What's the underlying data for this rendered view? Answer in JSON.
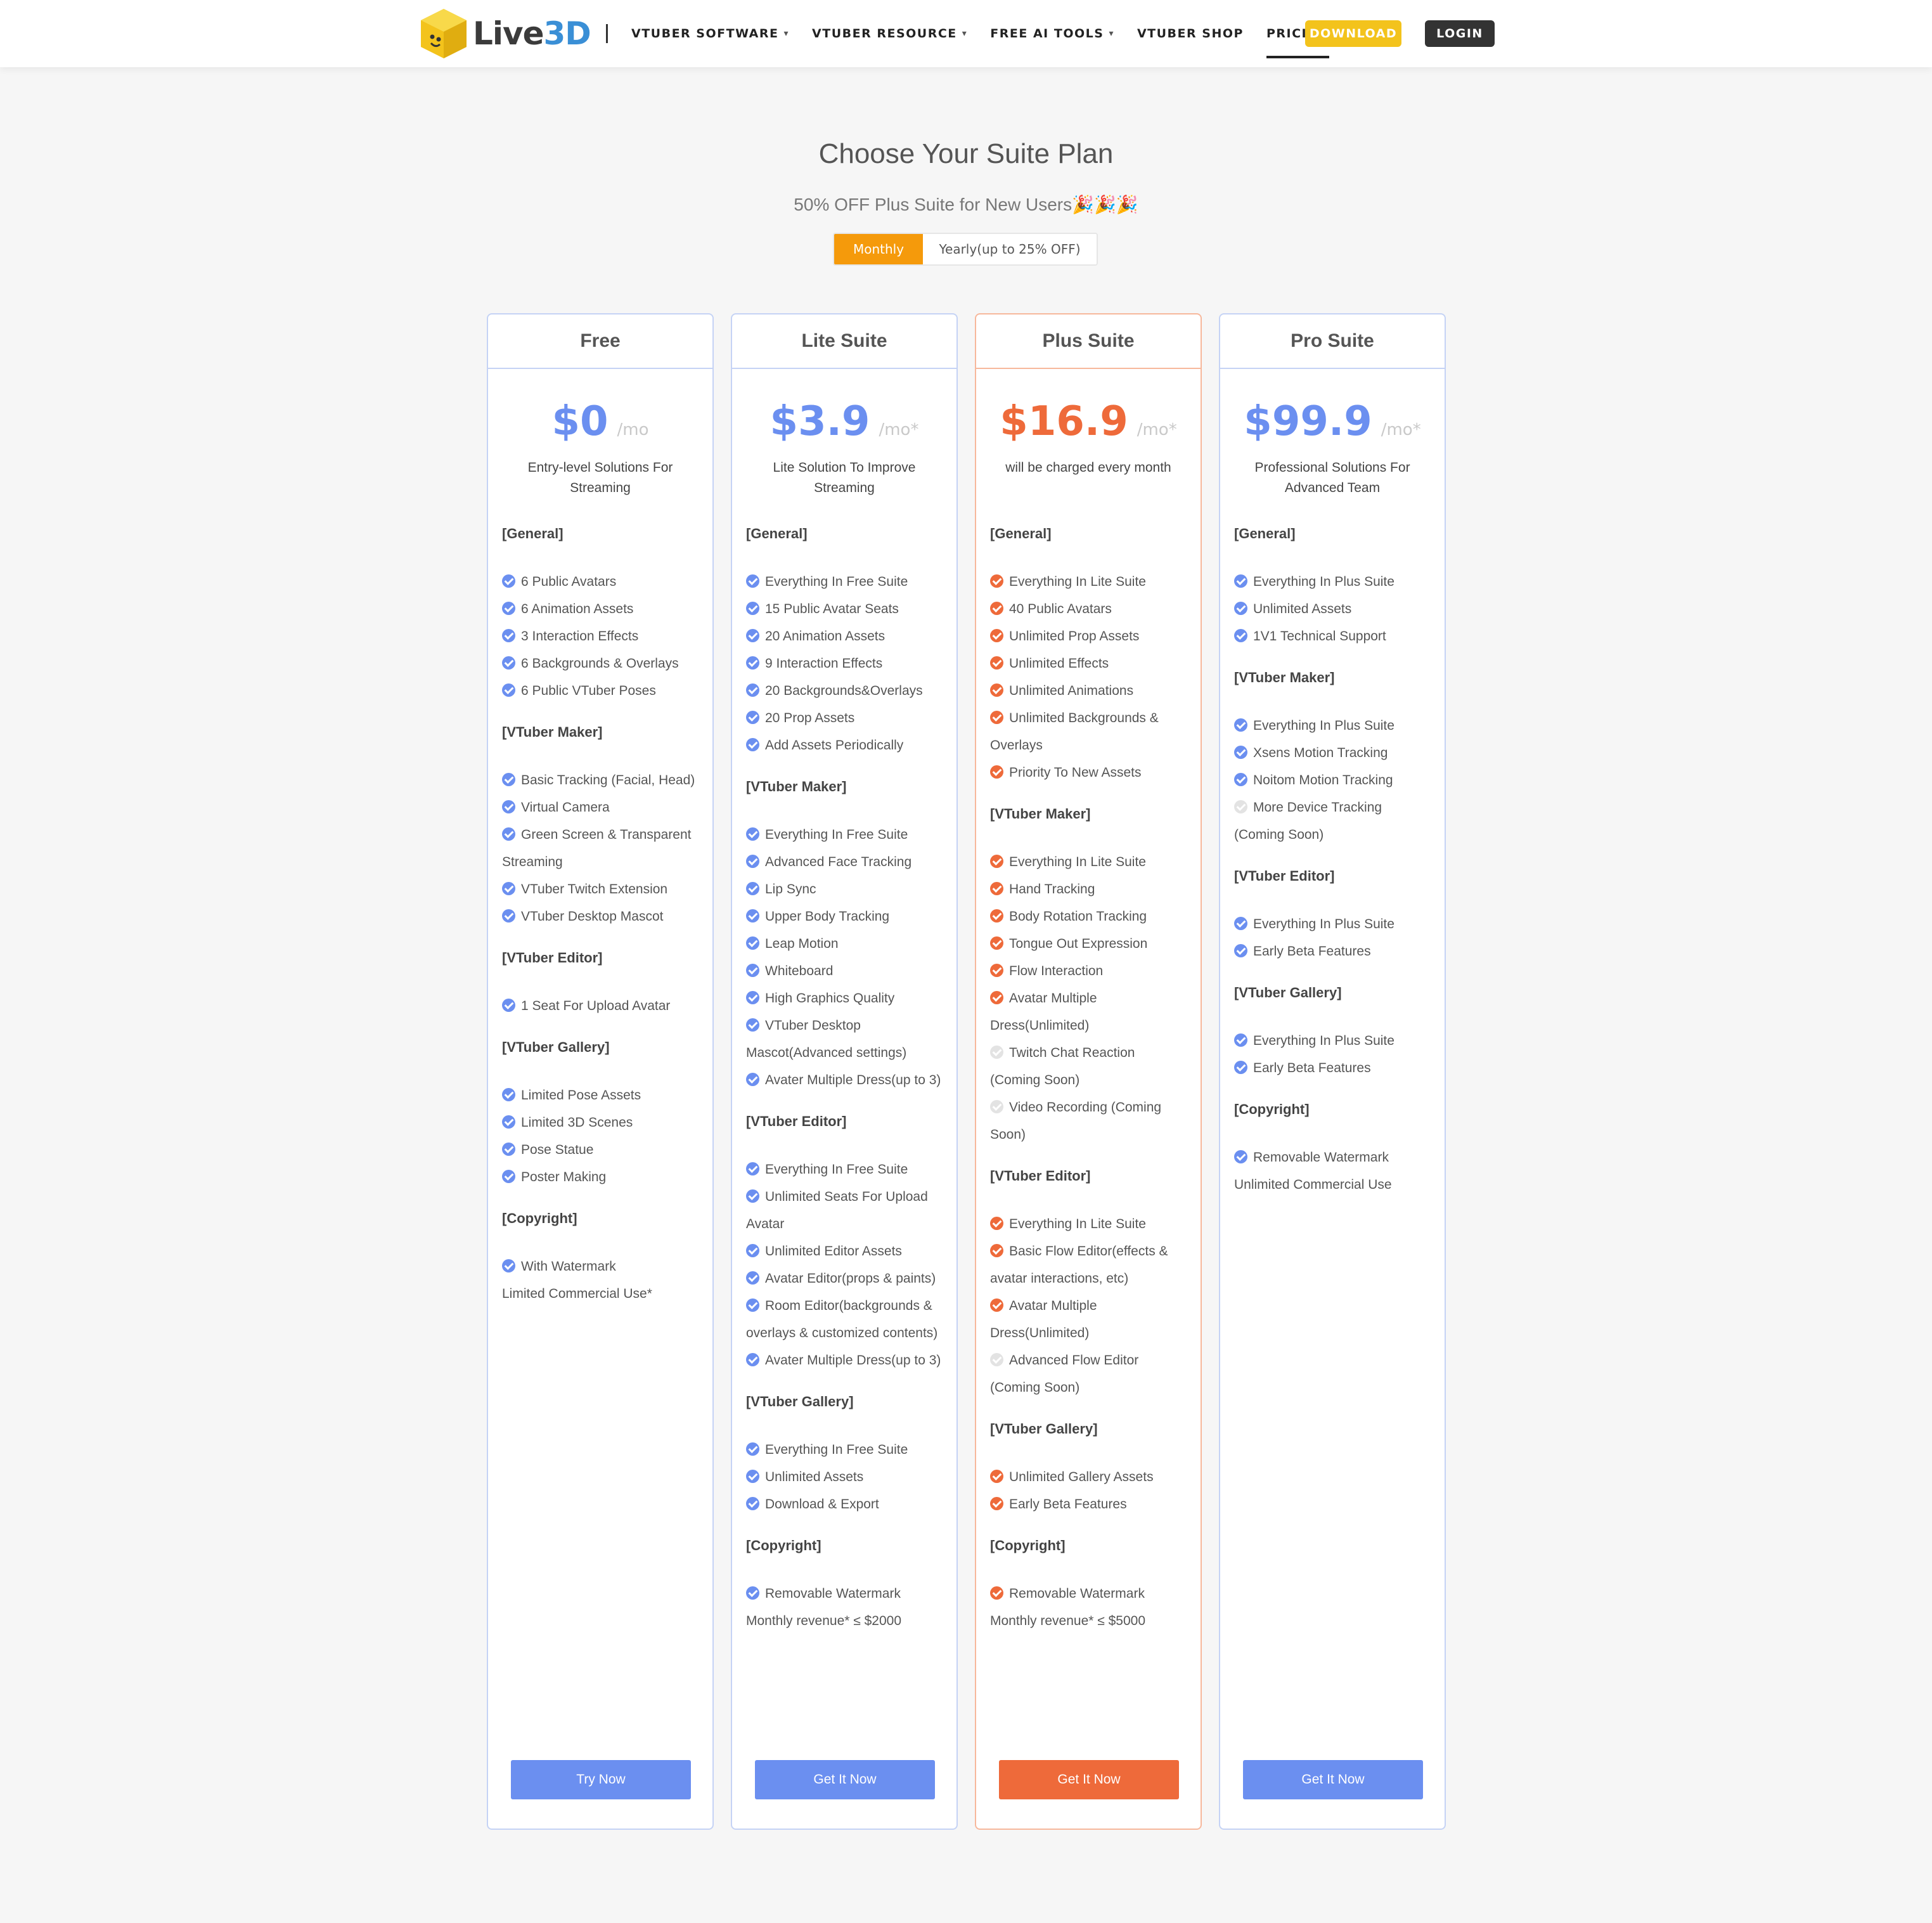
{
  "brand": {
    "logo_text_a": "Live",
    "logo_text_b": "3D",
    "logo_icon": "yellow-cube-icon"
  },
  "nav": {
    "items": [
      {
        "label": "VTUBER SOFTWARE",
        "caret": "▾"
      },
      {
        "label": "VTUBER RESOURCE",
        "caret": "▾"
      },
      {
        "label": "FREE AI TOOLS",
        "caret": "▾"
      },
      {
        "label": "VTUBER SHOP"
      },
      {
        "label": "PRICING"
      }
    ],
    "download_label": "DOWNLOAD",
    "login_label": "LOGIN"
  },
  "hero": {
    "title": "Choose Your Suite Plan",
    "subtitle": "50% OFF Plus Suite for New Users🎉🎉🎉",
    "toggle_monthly": "Monthly",
    "toggle_yearly": "Yearly(up to 25% OFF)"
  },
  "colors": {
    "accent_blue": "#6b8ff0",
    "accent_orange": "#ee6a3a",
    "download_yellow": "#f3c31c",
    "toggle_orange": "#f59a0b"
  },
  "plans": [
    {
      "name": "Free",
      "price": "$0",
      "per": "/mo",
      "desc": "Entry-level Solutions For Streaming",
      "cta": "Try Now",
      "groups": [
        {
          "title": "[General]",
          "items": [
            "6 Public Avatars",
            "6 Animation Assets",
            "3 Interaction Effects",
            "6 Backgrounds & Overlays",
            "6 Public VTuber Poses"
          ]
        },
        {
          "title": "[VTuber Maker]",
          "items": [
            "Basic Tracking (Facial, Head)",
            "Virtual Camera",
            "Green Screen & Transparent Streaming",
            "VTuber Twitch Extension",
            "VTuber Desktop Mascot"
          ]
        },
        {
          "title": "[VTuber Editor]",
          "items": [
            "1 Seat For Upload Avatar"
          ]
        },
        {
          "title": "[VTuber Gallery]",
          "items": [
            "Limited Pose Assets",
            "Limited 3D Scenes",
            "Pose Statue",
            "Poster Making"
          ]
        },
        {
          "title": "[Copyright]",
          "items": [
            "With Watermark"
          ],
          "note": "Limited Commercial Use*"
        }
      ]
    },
    {
      "name": "Lite Suite",
      "price": "$3.9",
      "per": "/mo*",
      "desc": "Lite Solution To Improve Streaming",
      "cta": "Get It Now",
      "groups": [
        {
          "title": "[General]",
          "items": [
            "Everything In Free Suite",
            "15 Public Avatar Seats",
            "20 Animation Assets",
            "9 Interaction Effects",
            "20 Backgrounds&Overlays",
            "20 Prop Assets",
            "Add Assets Periodically"
          ]
        },
        {
          "title": "[VTuber Maker]",
          "items": [
            "Everything In Free Suite",
            "Advanced Face Tracking",
            "Lip Sync",
            "Upper Body Tracking",
            "Leap Motion",
            "Whiteboard",
            "High Graphics Quality",
            "VTuber Desktop Mascot(Advanced settings)",
            "Avater Multiple Dress(up to 3)"
          ]
        },
        {
          "title": "[VTuber Editor]",
          "items": [
            "Everything In Free Suite",
            "Unlimited Seats For Upload Avatar",
            "Unlimited Editor Assets",
            "Avatar Editor(props & paints)",
            "Room Editor(backgrounds & overlays & customized contents)",
            "Avater Multiple Dress(up to 3)"
          ]
        },
        {
          "title": "[VTuber Gallery]",
          "items": [
            "Everything In Free Suite",
            "Unlimited Assets",
            "Download & Export"
          ]
        },
        {
          "title": "[Copyright]",
          "items": [
            "Removable Watermark"
          ],
          "note": "Monthly revenue* ≤ $2000"
        }
      ]
    },
    {
      "name": "Plus Suite",
      "price": "$16.9",
      "per": "/mo*",
      "desc": "will be charged every month",
      "cta": "Get It Now",
      "highlight": true,
      "groups": [
        {
          "title": "[General]",
          "items": [
            "Everything In Lite Suite",
            "40 Public Avatars",
            "Unlimited Prop Assets",
            "Unlimited Effects",
            "Unlimited Animations",
            "Unlimited Backgrounds & Overlays",
            "Priority To New Assets"
          ]
        },
        {
          "title": "[VTuber Maker]",
          "items": [
            "Everything In Lite Suite",
            "Hand Tracking",
            "Body Rotation Tracking",
            "Tongue Out Expression",
            "Flow Interaction",
            "Avatar Multiple Dress(Unlimited)",
            "~Twitch Chat Reaction (Coming Soon)",
            "~Video Recording (Coming Soon)"
          ]
        },
        {
          "title": "[VTuber Editor]",
          "items": [
            "Everything In Lite Suite",
            "Basic Flow Editor(effects & avatar interactions, etc)",
            "Avatar Multiple Dress(Unlimited)",
            "~Advanced Flow Editor (Coming Soon)"
          ]
        },
        {
          "title": "[VTuber Gallery]",
          "items": [
            "Unlimited Gallery Assets",
            "Early Beta Features"
          ]
        },
        {
          "title": "[Copyright]",
          "items": [
            "Removable Watermark"
          ],
          "note": "Monthly revenue* ≤ $5000"
        }
      ]
    },
    {
      "name": "Pro Suite",
      "price": "$99.9",
      "per": "/mo*",
      "desc": "Professional Solutions For Advanced Team",
      "cta": "Get It Now",
      "groups": [
        {
          "title": "[General]",
          "items": [
            "Everything In Plus Suite",
            "Unlimited Assets",
            "1V1 Technical Support"
          ]
        },
        {
          "title": "[VTuber Maker]",
          "items": [
            "Everything In Plus Suite",
            "Xsens Motion Tracking",
            "Noitom Motion Tracking",
            "~More Device Tracking (Coming Soon)"
          ]
        },
        {
          "title": "[VTuber Editor]",
          "items": [
            "Everything In Plus Suite",
            "Early Beta Features"
          ]
        },
        {
          "title": "[VTuber Gallery]",
          "items": [
            "Everything In Plus Suite",
            "Early Beta Features"
          ]
        },
        {
          "title": "[Copyright]",
          "items": [
            "Removable Watermark"
          ],
          "note": "Unlimited Commercial Use"
        }
      ]
    }
  ]
}
